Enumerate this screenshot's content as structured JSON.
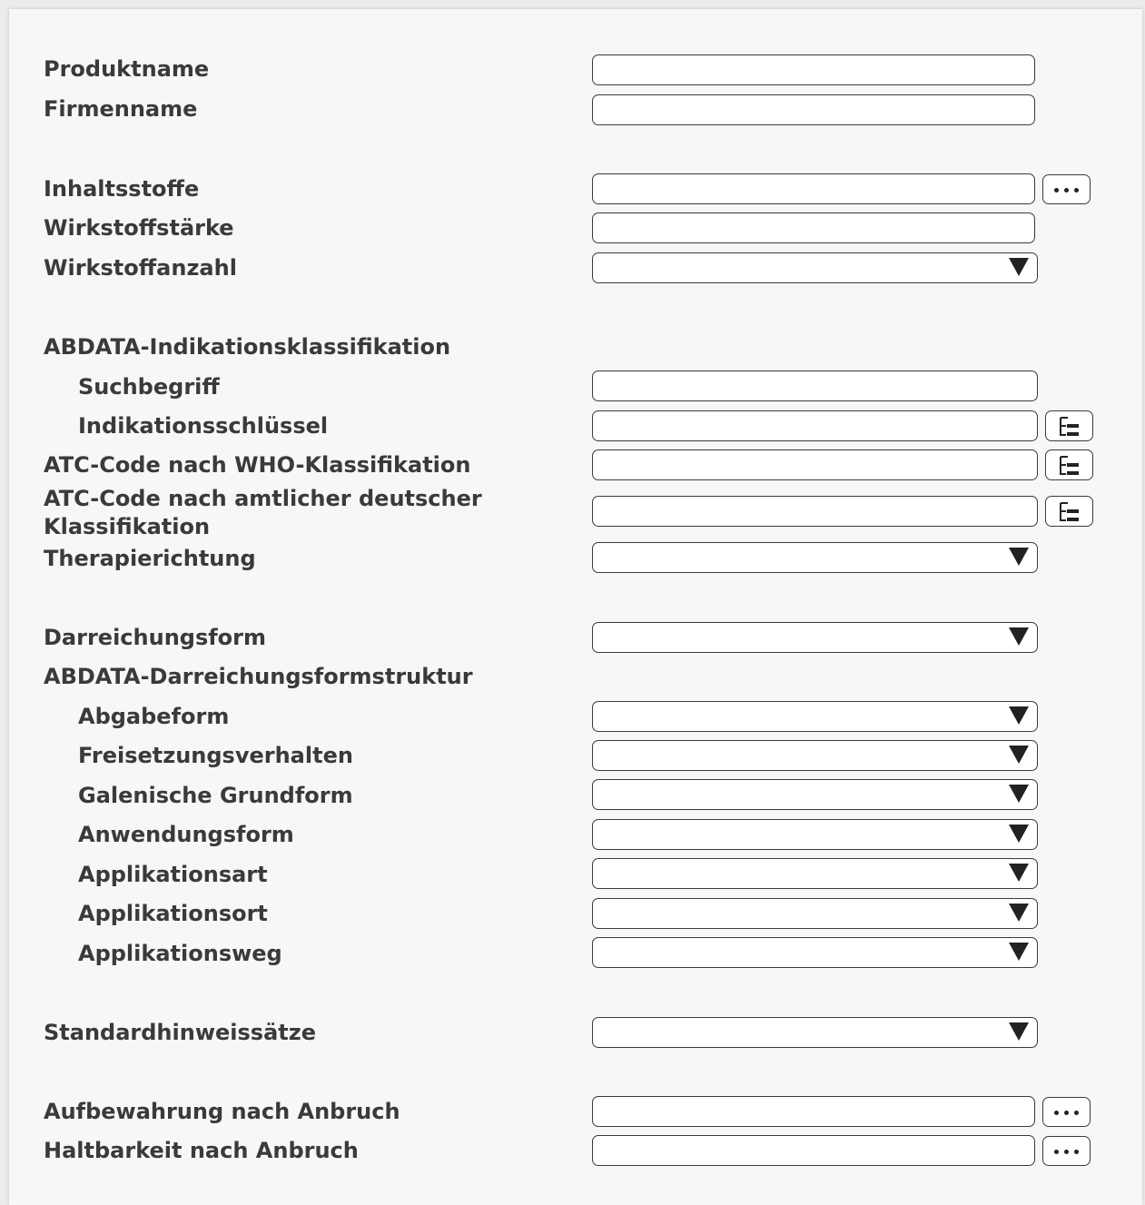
{
  "fields": {
    "produktname": "Produktname",
    "firmenname": "Firmenname",
    "inhaltsstoffe": "Inhaltsstoffe",
    "wirkstoffstaerke": "Wirkstoffstärke",
    "wirkstoffanzahl": "Wirkstoffanzahl",
    "abdata_indikationsklassifikation": "ABDATA-Indikationsklassifikation",
    "suchbegriff": "Suchbegriff",
    "indikationsschluessel": "Indikationsschlüssel",
    "atc_who": "ATC-Code nach WHO-Klassifikation",
    "atc_amtlich": "ATC-Code nach amtlicher deutscher Klassifikation",
    "therapierichtung": "Therapierichtung",
    "darreichungsform": "Darreichungsform",
    "abdata_darreichungsformstruktur": "ABDATA-Darreichungsformstruktur",
    "abgabeform": "Abgabeform",
    "freisetzungsverhalten": "Freisetzungsverhalten",
    "galenische_grundform": "Galenische Grundform",
    "anwendungsform": "Anwendungsform",
    "applikationsart": "Applikationsart",
    "applikationsort": "Applikationsort",
    "applikationsweg": "Applikationsweg",
    "standardhinweissaetze": "Standardhinweissätze",
    "aufbewahrung_nach_anbruch": "Aufbewahrung nach Anbruch",
    "haltbarkeit_nach_anbruch": "Haltbarkeit nach Anbruch"
  },
  "icons": {
    "more": "ellipsis-icon",
    "tree": "tree-hierarchy-icon",
    "dropdown": "triangle-down-icon"
  }
}
